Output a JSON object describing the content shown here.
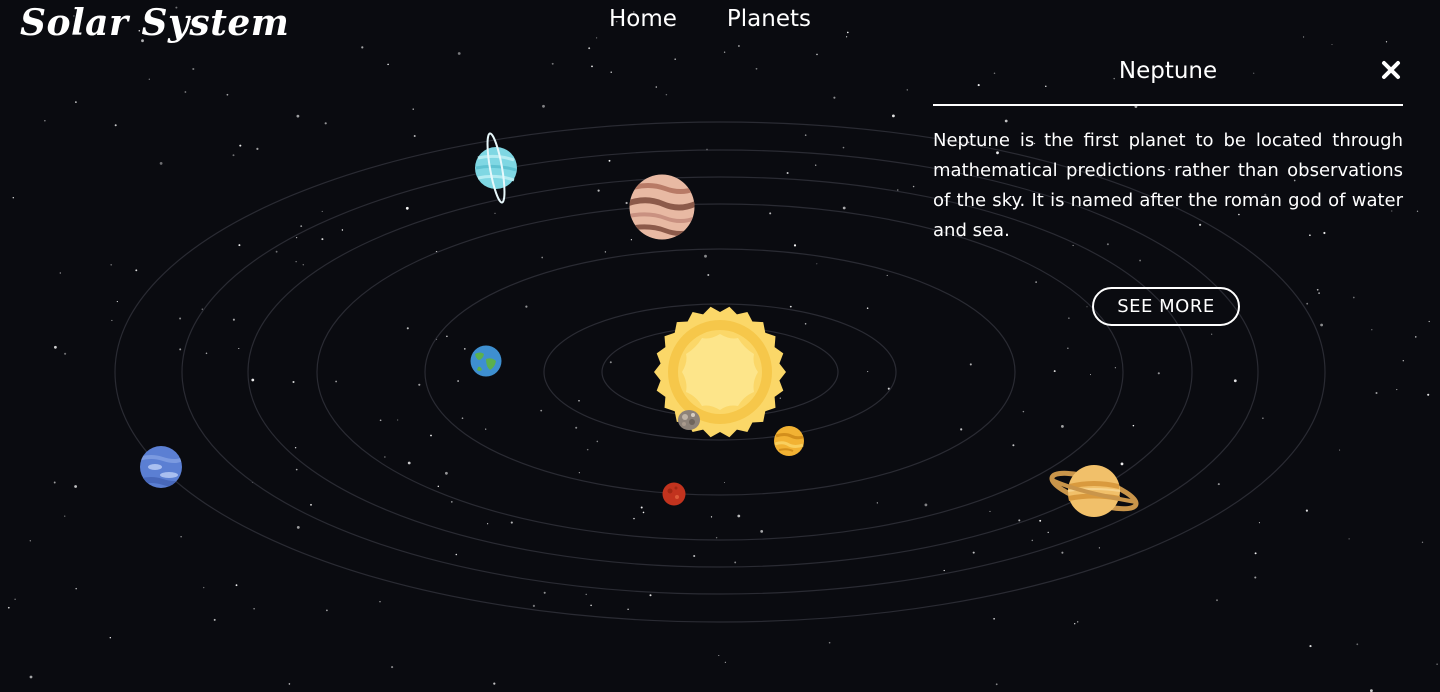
{
  "brand": {
    "title": "Solar System"
  },
  "nav": {
    "home_label": "Home",
    "planets_label": "Planets"
  },
  "info_panel": {
    "title": "Neptune",
    "description": "Neptune is the first planet to be located through mathematical predictions rather than observations of the sky. It is named after the roman god of water and sea.",
    "button_label": "SEE MORE",
    "close_icon": "close-icon"
  },
  "planets": [
    "Sun",
    "Mercury",
    "Venus",
    "Earth",
    "Mars",
    "Jupiter",
    "Saturn",
    "Uranus",
    "Neptune"
  ],
  "colors": {
    "background": "#0a0b10",
    "orbit": "#2a2b33",
    "text": "#ffffff"
  }
}
